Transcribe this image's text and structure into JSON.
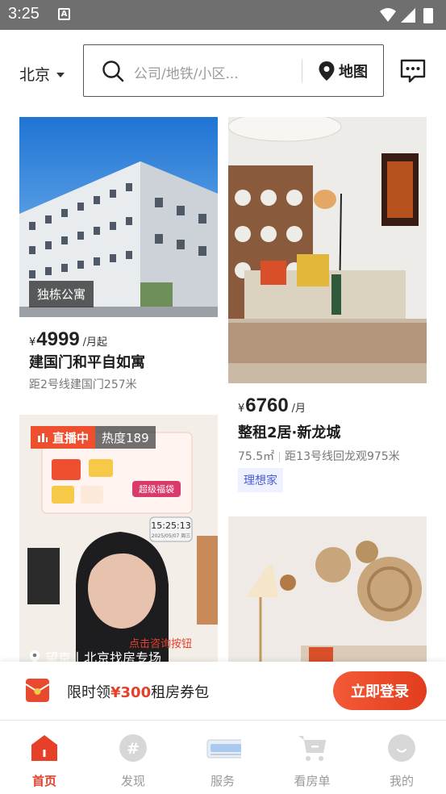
{
  "status_bar": {
    "time": "3:25",
    "notif_icon": "A"
  },
  "header": {
    "city": "北京",
    "search_placeholder": "公司/地铁/小区...",
    "map_label": "地图"
  },
  "listings": [
    {
      "tag": "独栋公寓",
      "currency": "¥",
      "price": "4999",
      "unit": "/月起",
      "title": "建国门和平自如寓",
      "meta": "距2号线建国门257米"
    },
    {
      "currency": "¥",
      "price": "6760",
      "unit": "/月",
      "title": "整租2居·新龙城",
      "area": "75.5㎡",
      "meta": "距13号线回龙观975米",
      "badge": "理想家"
    },
    {
      "live_label": "直播中",
      "heat_label": "热度189",
      "location": "望京丨北京找房专场",
      "overlay_clock": "15:25:13",
      "overlay_date": "2025/05/07 周三",
      "overlay_banner": "超级福袋",
      "overlay_caption": "点击咨询按钮"
    },
    {}
  ],
  "promo": {
    "prefix": "限时领",
    "amount": "¥300",
    "suffix": "租房券包",
    "button": "立即登录"
  },
  "bottom_nav": [
    {
      "label": "首页",
      "icon": "home-icon",
      "active": true
    },
    {
      "label": "发现",
      "icon": "discover-icon",
      "active": false
    },
    {
      "label": "服务",
      "icon": "service-icon",
      "active": false
    },
    {
      "label": "看房单",
      "icon": "cart-icon",
      "active": false
    },
    {
      "label": "我的",
      "icon": "profile-icon",
      "active": false
    }
  ],
  "colors": {
    "accent": "#e6402a",
    "badge_blue": "#4a5bd8",
    "status_bar": "#6f6f6f"
  }
}
